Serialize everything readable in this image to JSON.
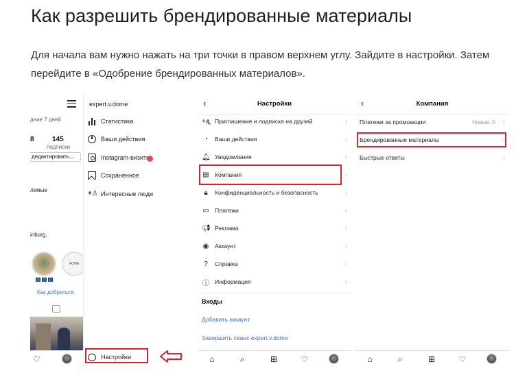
{
  "article": {
    "title": "Как разрешить брендированные материалы",
    "text": "Для начала вам нужно нажать на три точки в правом верхнем углу. Зайдите в настройки. Затем перейдите в «Одобрение брендированных материалов»."
  },
  "panel1": {
    "profile": {
      "days_text": "дние 7 дней",
      "following_count": "145",
      "following_label": "подписки",
      "edit_button": "дедактировать…",
      "highlights_label": "лемые",
      "city": "inburg,",
      "story2_text": "ЯОМЕ",
      "directions_link": "Как добраться"
    },
    "drawer": {
      "username": "expert.v.dome",
      "items": [
        {
          "label": "Статистика",
          "icon": "bar-chart-icon"
        },
        {
          "label": "Ваши действия",
          "icon": "activity-clock-icon"
        },
        {
          "label": "Instagram-визитка",
          "icon": "nametag-icon"
        },
        {
          "label": "Сохраненное",
          "icon": "bookmark-icon"
        },
        {
          "label": "Интересные люди",
          "icon": "add-person-icon"
        }
      ],
      "settings_label": "Настройки"
    }
  },
  "panel2": {
    "title": "Настройки",
    "items": [
      {
        "label": "Приглашение и подписка на друзей",
        "icon": "+ዺ"
      },
      {
        "label": "Ваши действия",
        "icon": "◔"
      },
      {
        "label": "Уведомления",
        "icon": "🔔︎"
      },
      {
        "label": "Компания",
        "icon": "▤"
      },
      {
        "label": "Конфиденциальность и безопасность",
        "icon": "🔒︎"
      },
      {
        "label": "Платежи",
        "icon": "▭"
      },
      {
        "label": "Реклама",
        "icon": "📢︎"
      },
      {
        "label": "Аккаунт",
        "icon": "◉"
      },
      {
        "label": "Справка",
        "icon": "?"
      },
      {
        "label": "Информация",
        "icon": "ⓘ"
      }
    ],
    "section_logins": "Входы",
    "add_account": "Добавить аккаунт",
    "logout": "Завершить сеанс expert.v.dome"
  },
  "panel3": {
    "title": "Компания",
    "items": [
      {
        "label": "Платежи за промоакции",
        "badge": "Новые: 0"
      },
      {
        "label": "Брендированные материалы",
        "badge": ""
      },
      {
        "label": "Быстрые ответы",
        "badge": ""
      }
    ]
  },
  "colors": {
    "highlight_red": "#d9222a",
    "link_blue": "#3d72c2",
    "notification_red": "#e64d5c"
  }
}
